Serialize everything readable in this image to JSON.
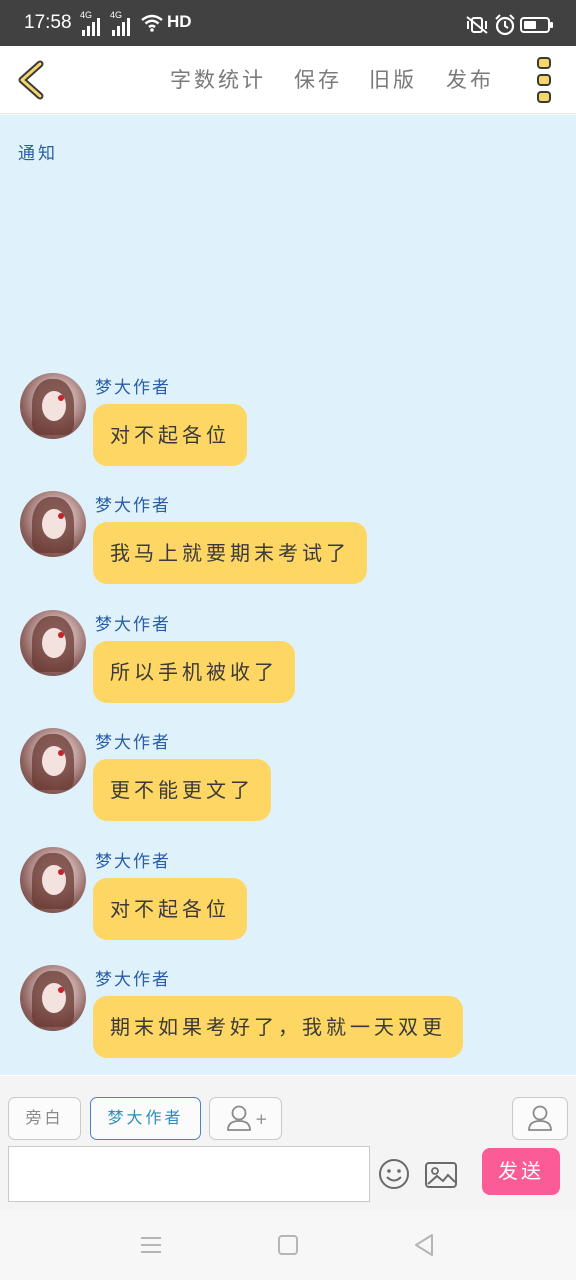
{
  "status_bar": {
    "time": "17:58",
    "network_1": "4G",
    "network_2": "4G",
    "hd": "HD",
    "battery_level": 0.4
  },
  "toolbar": {
    "word_count_label": "字数统计",
    "save_label": "保存",
    "old_version_label": "旧版",
    "publish_label": "发布"
  },
  "chat": {
    "notice_label": "通知",
    "messages": [
      {
        "sender": "梦大作者",
        "text": "对不起各位"
      },
      {
        "sender": "梦大作者",
        "text": "我马上就要期末考试了"
      },
      {
        "sender": "梦大作者",
        "text": "所以手机被收了"
      },
      {
        "sender": "梦大作者",
        "text": "更不能更文了"
      },
      {
        "sender": "梦大作者",
        "text": "对不起各位"
      },
      {
        "sender": "梦大作者",
        "text": "期末如果考好了，我就一天双更"
      }
    ]
  },
  "input": {
    "narration_label": "旁白",
    "selected_role_label": "梦大作者",
    "add_role_plus": "+",
    "text_value": "",
    "send_label": "发送"
  },
  "colors": {
    "bubble": "#fdd664",
    "chat_bg": "#dff1fb",
    "send": "#fb5b97",
    "name": "#2a5fa5"
  }
}
